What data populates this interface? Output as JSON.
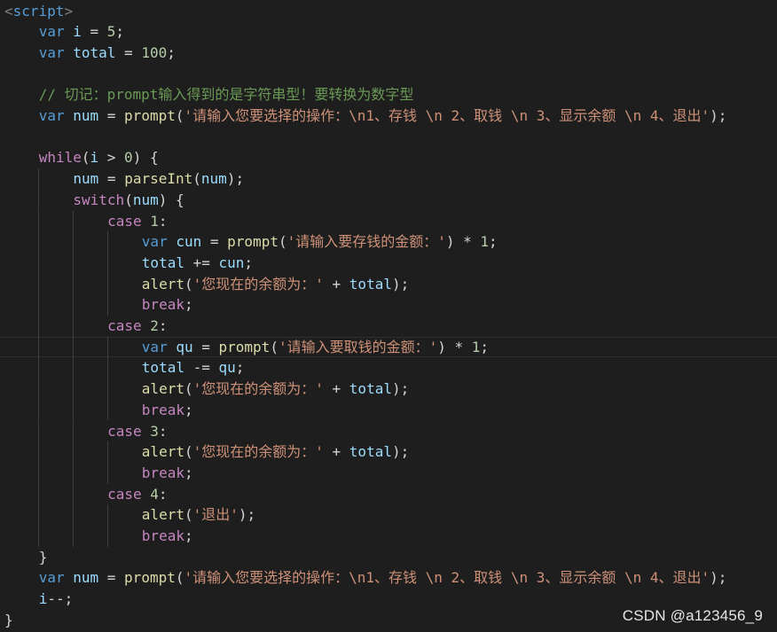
{
  "editor": {
    "lines": [
      {
        "indent": 0,
        "tokens": [
          {
            "t": "tag",
            "v": "<"
          },
          {
            "t": "tagname",
            "v": "script"
          },
          {
            "t": "tag",
            "v": ">"
          }
        ]
      },
      {
        "indent": 1,
        "tokens": [
          {
            "t": "kw",
            "v": "var"
          },
          {
            "t": "op",
            "v": " "
          },
          {
            "t": "var",
            "v": "i"
          },
          {
            "t": "op",
            "v": " = "
          },
          {
            "t": "num",
            "v": "5"
          },
          {
            "t": "op",
            "v": ";"
          }
        ]
      },
      {
        "indent": 1,
        "tokens": [
          {
            "t": "kw",
            "v": "var"
          },
          {
            "t": "op",
            "v": " "
          },
          {
            "t": "var",
            "v": "total"
          },
          {
            "t": "op",
            "v": " = "
          },
          {
            "t": "num",
            "v": "100"
          },
          {
            "t": "op",
            "v": ";"
          }
        ]
      },
      {
        "indent": 1,
        "tokens": []
      },
      {
        "indent": 1,
        "tokens": [
          {
            "t": "com",
            "v": "// 切记：prompt输入得到的是字符串型！要转换为数字型"
          }
        ]
      },
      {
        "indent": 1,
        "tokens": [
          {
            "t": "kw",
            "v": "var"
          },
          {
            "t": "op",
            "v": " "
          },
          {
            "t": "var",
            "v": "num"
          },
          {
            "t": "op",
            "v": " = "
          },
          {
            "t": "fn",
            "v": "prompt"
          },
          {
            "t": "op",
            "v": "("
          },
          {
            "t": "str",
            "v": "'请输入您要选择的操作：\\n1、存钱 \\n 2、取钱 \\n 3、显示余额 \\n 4、退出'"
          },
          {
            "t": "op",
            "v": ");"
          }
        ]
      },
      {
        "indent": 1,
        "tokens": []
      },
      {
        "indent": 1,
        "tokens": [
          {
            "t": "ctrl",
            "v": "while"
          },
          {
            "t": "op",
            "v": "("
          },
          {
            "t": "var",
            "v": "i"
          },
          {
            "t": "op",
            "v": " > "
          },
          {
            "t": "num",
            "v": "0"
          },
          {
            "t": "op",
            "v": ") {"
          }
        ]
      },
      {
        "indent": 2,
        "tokens": [
          {
            "t": "var",
            "v": "num"
          },
          {
            "t": "op",
            "v": " = "
          },
          {
            "t": "fn",
            "v": "parseInt"
          },
          {
            "t": "op",
            "v": "("
          },
          {
            "t": "var",
            "v": "num"
          },
          {
            "t": "op",
            "v": ");"
          }
        ]
      },
      {
        "indent": 2,
        "tokens": [
          {
            "t": "ctrl",
            "v": "switch"
          },
          {
            "t": "op",
            "v": "("
          },
          {
            "t": "var",
            "v": "num"
          },
          {
            "t": "op",
            "v": ") {"
          }
        ]
      },
      {
        "indent": 3,
        "tokens": [
          {
            "t": "ctrl",
            "v": "case"
          },
          {
            "t": "op",
            "v": " "
          },
          {
            "t": "num",
            "v": "1"
          },
          {
            "t": "op",
            "v": ":"
          }
        ]
      },
      {
        "indent": 4,
        "tokens": [
          {
            "t": "kw",
            "v": "var"
          },
          {
            "t": "op",
            "v": " "
          },
          {
            "t": "var",
            "v": "cun"
          },
          {
            "t": "op",
            "v": " = "
          },
          {
            "t": "fn",
            "v": "prompt"
          },
          {
            "t": "op",
            "v": "("
          },
          {
            "t": "str",
            "v": "'请输入要存钱的金额：'"
          },
          {
            "t": "op",
            "v": ") * "
          },
          {
            "t": "num",
            "v": "1"
          },
          {
            "t": "op",
            "v": ";"
          }
        ]
      },
      {
        "indent": 4,
        "tokens": [
          {
            "t": "var",
            "v": "total"
          },
          {
            "t": "op",
            "v": " += "
          },
          {
            "t": "var",
            "v": "cun"
          },
          {
            "t": "op",
            "v": ";"
          }
        ]
      },
      {
        "indent": 4,
        "tokens": [
          {
            "t": "fn",
            "v": "alert"
          },
          {
            "t": "op",
            "v": "("
          },
          {
            "t": "str",
            "v": "'您现在的余额为：'"
          },
          {
            "t": "op",
            "v": " + "
          },
          {
            "t": "var",
            "v": "total"
          },
          {
            "t": "op",
            "v": ");"
          }
        ]
      },
      {
        "indent": 4,
        "tokens": [
          {
            "t": "ctrl",
            "v": "break"
          },
          {
            "t": "op",
            "v": ";"
          }
        ]
      },
      {
        "indent": 3,
        "tokens": [
          {
            "t": "ctrl",
            "v": "case"
          },
          {
            "t": "op",
            "v": " "
          },
          {
            "t": "num",
            "v": "2"
          },
          {
            "t": "op",
            "v": ":"
          }
        ]
      },
      {
        "indent": 4,
        "tokens": [
          {
            "t": "kw",
            "v": "var"
          },
          {
            "t": "op",
            "v": " "
          },
          {
            "t": "var",
            "v": "qu"
          },
          {
            "t": "op",
            "v": " = "
          },
          {
            "t": "fn",
            "v": "prompt"
          },
          {
            "t": "op",
            "v": "("
          },
          {
            "t": "str",
            "v": "'请输入要取钱的金额：'"
          },
          {
            "t": "op",
            "v": ") * "
          },
          {
            "t": "num",
            "v": "1"
          },
          {
            "t": "op",
            "v": ";"
          }
        ],
        "current": true
      },
      {
        "indent": 4,
        "tokens": [
          {
            "t": "var",
            "v": "total"
          },
          {
            "t": "op",
            "v": " -= "
          },
          {
            "t": "var",
            "v": "qu"
          },
          {
            "t": "op",
            "v": ";"
          }
        ]
      },
      {
        "indent": 4,
        "tokens": [
          {
            "t": "fn",
            "v": "alert"
          },
          {
            "t": "op",
            "v": "("
          },
          {
            "t": "str",
            "v": "'您现在的余额为：'"
          },
          {
            "t": "op",
            "v": " + "
          },
          {
            "t": "var",
            "v": "total"
          },
          {
            "t": "op",
            "v": ");"
          }
        ]
      },
      {
        "indent": 4,
        "tokens": [
          {
            "t": "ctrl",
            "v": "break"
          },
          {
            "t": "op",
            "v": ";"
          }
        ]
      },
      {
        "indent": 3,
        "tokens": [
          {
            "t": "ctrl",
            "v": "case"
          },
          {
            "t": "op",
            "v": " "
          },
          {
            "t": "num",
            "v": "3"
          },
          {
            "t": "op",
            "v": ":"
          }
        ]
      },
      {
        "indent": 4,
        "tokens": [
          {
            "t": "fn",
            "v": "alert"
          },
          {
            "t": "op",
            "v": "("
          },
          {
            "t": "str",
            "v": "'您现在的余额为：'"
          },
          {
            "t": "op",
            "v": " + "
          },
          {
            "t": "var",
            "v": "total"
          },
          {
            "t": "op",
            "v": ");"
          }
        ]
      },
      {
        "indent": 4,
        "tokens": [
          {
            "t": "ctrl",
            "v": "break"
          },
          {
            "t": "op",
            "v": ";"
          }
        ]
      },
      {
        "indent": 3,
        "tokens": [
          {
            "t": "ctrl",
            "v": "case"
          },
          {
            "t": "op",
            "v": " "
          },
          {
            "t": "num",
            "v": "4"
          },
          {
            "t": "op",
            "v": ":"
          }
        ]
      },
      {
        "indent": 4,
        "tokens": [
          {
            "t": "fn",
            "v": "alert"
          },
          {
            "t": "op",
            "v": "("
          },
          {
            "t": "str",
            "v": "'退出'"
          },
          {
            "t": "op",
            "v": ");"
          }
        ]
      },
      {
        "indent": 4,
        "tokens": [
          {
            "t": "ctrl",
            "v": "break"
          },
          {
            "t": "op",
            "v": ";"
          }
        ]
      },
      {
        "indent": 1,
        "tokens": [
          {
            "t": "op",
            "v": "}"
          }
        ]
      },
      {
        "indent": 1,
        "tokens": [
          {
            "t": "kw",
            "v": "var"
          },
          {
            "t": "op",
            "v": " "
          },
          {
            "t": "var",
            "v": "num"
          },
          {
            "t": "op",
            "v": " = "
          },
          {
            "t": "fn",
            "v": "prompt"
          },
          {
            "t": "op",
            "v": "("
          },
          {
            "t": "str",
            "v": "'请输入您要选择的操作：\\n1、存钱 \\n 2、取钱 \\n 3、显示余额 \\n 4、退出'"
          },
          {
            "t": "op",
            "v": ");"
          }
        ]
      },
      {
        "indent": 1,
        "tokens": [
          {
            "t": "var",
            "v": "i"
          },
          {
            "t": "op",
            "v": "--;"
          }
        ]
      },
      {
        "indent": 0,
        "tokens": [
          {
            "t": "op",
            "v": "}"
          }
        ]
      }
    ]
  },
  "watermark": {
    "text": "CSDN @a123456_9"
  },
  "colors": {
    "background": "#1e1e1e",
    "keyword": "#569cd6",
    "control": "#c586c0",
    "variable": "#9cdcfe",
    "function": "#dcdcaa",
    "string": "#ce9178",
    "number": "#b5cea8",
    "comment": "#6a9955"
  }
}
